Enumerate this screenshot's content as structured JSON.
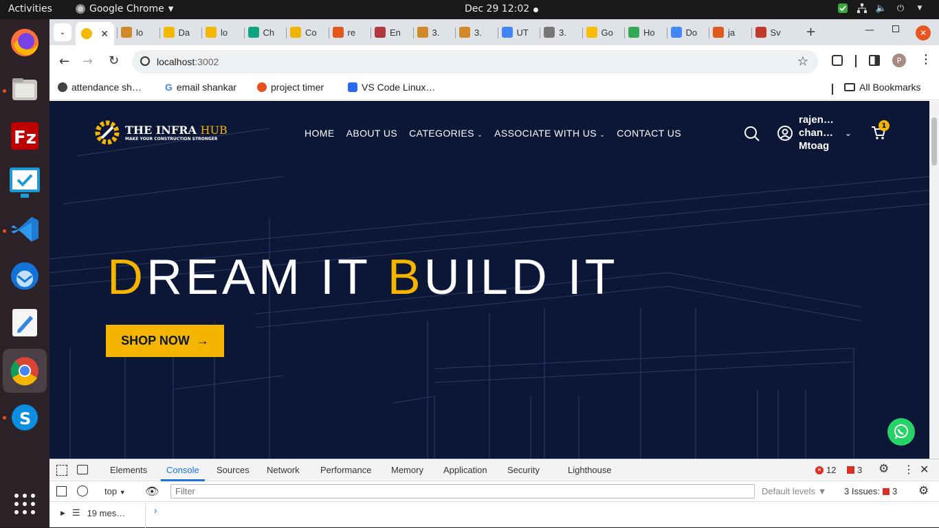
{
  "os": {
    "activities": "Activities",
    "app": "Google Chrome",
    "clock": "Dec 29  12:02"
  },
  "tabs": [
    {
      "label": "",
      "color": "#f5b800"
    },
    {
      "label": "lo",
      "color": "#d08a2a"
    },
    {
      "label": "Da",
      "color": "#f5b800"
    },
    {
      "label": "lo",
      "color": "#f5b800"
    },
    {
      "label": "Ch",
      "color": "#10a37f"
    },
    {
      "label": "Co",
      "color": "#f0b400"
    },
    {
      "label": "re",
      "color": "#e0581b"
    },
    {
      "label": "En",
      "color": "#b0373b"
    },
    {
      "label": "3.",
      "color": "#d08a2a"
    },
    {
      "label": "3.",
      "color": "#d08a2a"
    },
    {
      "label": "UT",
      "color": "#4285f4"
    },
    {
      "label": "3.",
      "color": "#777"
    },
    {
      "label": "Go",
      "color": "#fbbc04"
    },
    {
      "label": "Ho",
      "color": "#34a853"
    },
    {
      "label": "Do",
      "color": "#4285f4"
    },
    {
      "label": "ja",
      "color": "#e0581b"
    },
    {
      "label": "Sv",
      "color": "#c0392b"
    }
  ],
  "address": {
    "host": "localhost",
    "port": ":3002"
  },
  "bookmarks": {
    "items": [
      "attendance sh…",
      "email shankar",
      "project timer",
      "VS Code Linux…"
    ],
    "all": "All Bookmarks"
  },
  "site": {
    "logo_main": "THE INFRA",
    "logo_accent": "HUB",
    "logo_tag": "MAKE YOUR CONSTRUCTION STRONGER",
    "nav": [
      "HOME",
      "ABOUT US",
      "CATEGORIES",
      "ASSOCIATE WITH US",
      "CONTACT US"
    ],
    "user_lines": [
      "rajen…",
      "chan…",
      "Mtoag"
    ],
    "cart_count": "1",
    "hero": {
      "d1": "D",
      "rest1": "REAM IT ",
      "b1": "B",
      "rest2": "UILD IT"
    },
    "cta": "SHOP NOW",
    "accent": "#f5b400"
  },
  "devtools": {
    "tabs": [
      "Elements",
      "Console",
      "Sources",
      "Network",
      "Performance",
      "Memory",
      "Application",
      "Security",
      "Lighthouse"
    ],
    "active": "Console",
    "errors": "12",
    "warnings": "3",
    "context": "top",
    "filter_placeholder": "Filter",
    "levels": "Default levels",
    "issues_label": "3 Issues:",
    "issues_count": "3",
    "messages": "19 mes…"
  }
}
